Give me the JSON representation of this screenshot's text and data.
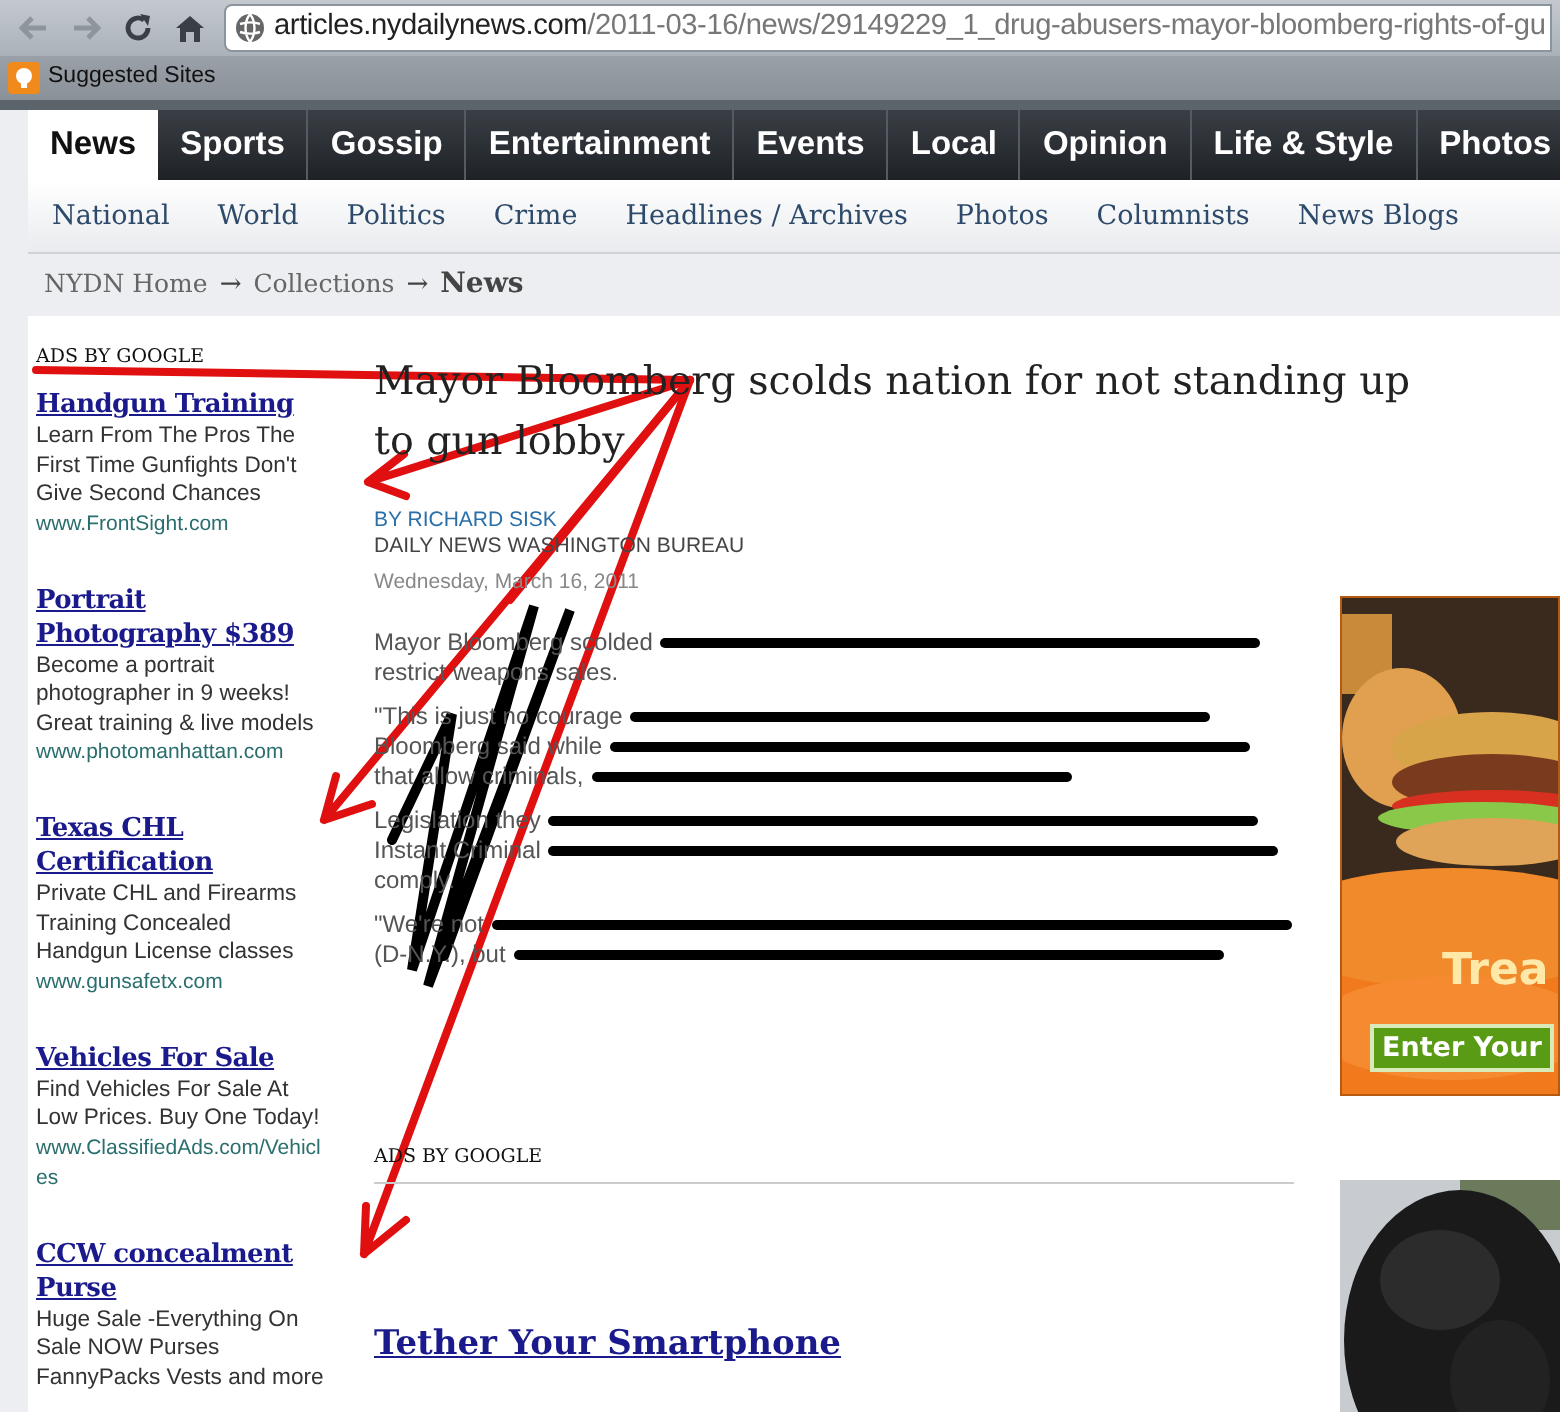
{
  "browser": {
    "back_disabled": true,
    "forward_disabled": true,
    "url_host": "articles.nydailynews.com",
    "url_path": "/2011-03-16/news/29149229_1_drug-abusers-mayor-bloomberg-rights-of-gu"
  },
  "bookmarks": [
    {
      "label": "Suggested Sites"
    }
  ],
  "main_nav": [
    {
      "label": "News",
      "selected": true
    },
    {
      "label": "Sports",
      "selected": false
    },
    {
      "label": "Gossip",
      "selected": false
    },
    {
      "label": "Entertainment",
      "selected": false
    },
    {
      "label": "Events",
      "selected": false
    },
    {
      "label": "Local",
      "selected": false
    },
    {
      "label": "Opinion",
      "selected": false
    },
    {
      "label": "Life & Style",
      "selected": false
    },
    {
      "label": "Photos",
      "selected": false
    }
  ],
  "sub_nav": [
    "National",
    "World",
    "Politics",
    "Crime",
    "Headlines / Archives",
    "Photos",
    "Columnists",
    "News Blogs"
  ],
  "breadcrumb": [
    {
      "kind": "link",
      "text": "NYDN Home"
    },
    {
      "kind": "separator",
      "text": "→"
    },
    {
      "kind": "link",
      "text": "Collections"
    },
    {
      "kind": "separator",
      "text": "→"
    },
    {
      "kind": "current",
      "text": "News"
    }
  ],
  "left_ads": {
    "header": "ADS BY GOOGLE",
    "ads": [
      {
        "title": "Handgun Training",
        "text": "Learn From The Pros The First Time Gunfights Don't Give Second Chances",
        "url": "www.FrontSight.com"
      },
      {
        "title": "Portrait Photography $389",
        "text": "Become a portrait photographer in 9 weeks! Great training & live models",
        "url": "www.photomanhattan.com"
      },
      {
        "title": "Texas CHL Certification",
        "text": "Private CHL and Firearms Training Concealed Handgun License classes",
        "url": "www.gunsafetx.com"
      },
      {
        "title": "Vehicles For Sale",
        "text": "Find Vehicles For Sale At Low Prices. Buy One Today!",
        "url": "www.ClassifiedAds.com/Vehicles"
      },
      {
        "title": "CCW concealment Purse",
        "text": "Huge Sale -Everything On Sale NOW Purses FannyPacks Vests and more"
      }
    ]
  },
  "article": {
    "headline_lines": [
      "Mayor Bloomberg scolds nation for not standing up",
      "to gun lobby"
    ],
    "byline": "BY RICHARD SISK",
    "bureau": "DAILY NEWS WASHINGTON BUREAU",
    "date": "Wednesday, March 16, 2011",
    "paragraphs": [
      [
        [
          {
            "kind": "text",
            "text": "Mayor Bloomberg scolded"
          },
          {
            "kind": "redaction"
          }
        ],
        [
          {
            "kind": "text",
            "text": "restrict weapons sales."
          }
        ]
      ],
      [
        [
          {
            "kind": "text",
            "text": "\"This is just no courage"
          },
          {
            "kind": "redaction"
          }
        ],
        [
          {
            "kind": "text",
            "text": "Bloomberg said while"
          },
          {
            "kind": "redaction"
          }
        ],
        [
          {
            "kind": "text",
            "text": "that allow criminals,"
          },
          {
            "kind": "redaction"
          }
        ]
      ],
      [
        [
          {
            "kind": "text",
            "text": "Legislation they"
          },
          {
            "kind": "redaction"
          }
        ],
        [
          {
            "kind": "text",
            "text": "Instant Criminal"
          },
          {
            "kind": "redaction"
          }
        ],
        [
          {
            "kind": "text",
            "text": "comply."
          }
        ]
      ],
      [
        [
          {
            "kind": "text",
            "text": "\"We're not"
          },
          {
            "kind": "redaction"
          }
        ],
        [
          {
            "kind": "text",
            "text": "(D-N.Y.), but"
          },
          {
            "kind": "redaction"
          }
        ]
      ]
    ]
  },
  "bottom_ads": {
    "header": "ADS BY GOOGLE",
    "ads": [
      {
        "title": "Tether Your Smartphone"
      }
    ]
  },
  "side": [
    {
      "kind": "banner",
      "headline": "Trea",
      "button": "Enter Your"
    },
    {
      "kind": "picture"
    }
  ]
}
